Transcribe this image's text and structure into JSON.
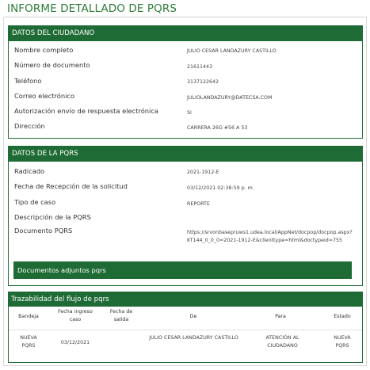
{
  "page": {
    "title": "INFORME DETALLADO DE PQRS"
  },
  "ciudadano": {
    "header": "DATOS DEL CIUDADANO",
    "fields": [
      {
        "label": "Nombre completo",
        "value": "JULIO CESAR LANDAZURY CASTILLO"
      },
      {
        "label": "Número de documento",
        "value": "21611443"
      },
      {
        "label": "Teléfono",
        "value": "3137122642"
      },
      {
        "label": "Correo electrónico",
        "value": "JULIOLANDAZURY@DATECSA.COM"
      },
      {
        "label": "Autorización envío de respuesta electrónica",
        "value": "SI"
      },
      {
        "label": "Dirección",
        "value": "CARRERA 26G #56 A 53"
      }
    ]
  },
  "pqrs": {
    "header": "DATOS DE LA PQRS",
    "fields": [
      {
        "label": "Radicado",
        "value": "2021-1912-E"
      },
      {
        "label": "Fecha de Recepción de la solicitud",
        "value": "03/12/2021 02:38:59 p. m."
      },
      {
        "label": "Tipo de caso",
        "value": "REPORTE"
      },
      {
        "label": "Descripción de la PQRS",
        "value": ""
      },
      {
        "label": "Documento PQRS",
        "value": "https://srvonbasepruws1.udea.local/AppNet/docpop/docpop.aspx?KT144_0_0_0=2021-1912-E&clienttype=html&doctypeid=755"
      }
    ],
    "docs_label": "Documentos adjuntos pqrs"
  },
  "trazabilidad": {
    "header": "Trazabilidad del flujo de pqrs",
    "columns": [
      "Bandeja",
      "Fecha ingreso caso",
      "Fecha de salida",
      "De",
      "Para",
      "Estado"
    ],
    "rows": [
      {
        "bandeja": "NUEVA PQRS",
        "fecha_ingreso": "03/12/2021",
        "fecha_salida": "",
        "de": "JULIO CESAR LANDAZURY CASTILLO",
        "para": "ATENCIÓN AL CIUDADANO",
        "estado": "NUEVA PQRS"
      }
    ]
  }
}
